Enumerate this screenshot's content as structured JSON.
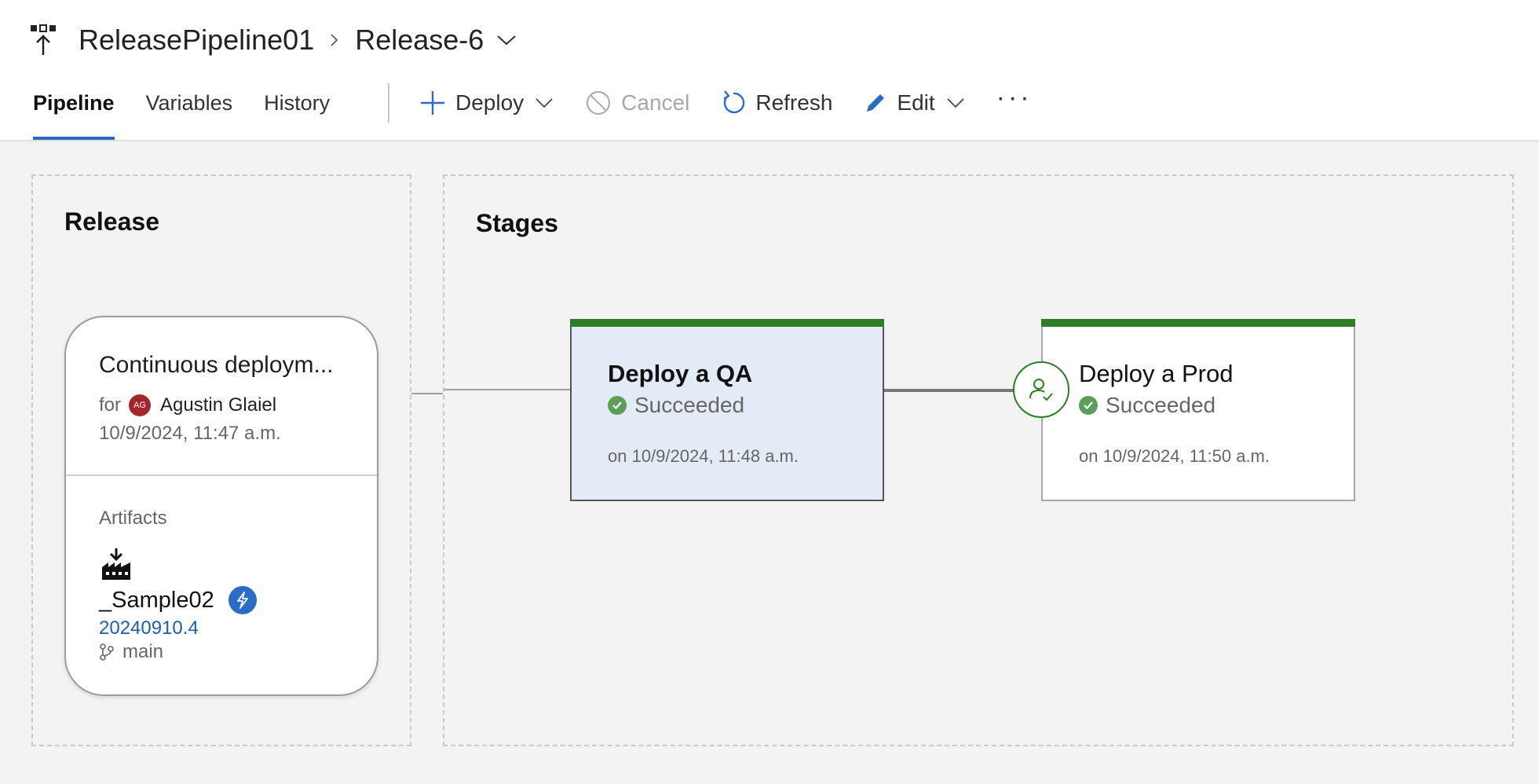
{
  "breadcrumb": {
    "pipeline": "ReleasePipeline01",
    "release": "Release-6"
  },
  "tabs": [
    {
      "label": "Pipeline",
      "active": true
    },
    {
      "label": "Variables",
      "active": false
    },
    {
      "label": "History",
      "active": false
    }
  ],
  "toolbar": {
    "deploy": "Deploy",
    "cancel": "Cancel",
    "refresh": "Refresh",
    "edit": "Edit",
    "more": "···"
  },
  "release_section": {
    "title": "Release",
    "card": {
      "title": "Continuous deploym...",
      "for_label": "for",
      "avatar_initials": "AG",
      "user": "Agustin Glaiel",
      "date": "10/9/2024, 11:47 a.m.",
      "artifacts_label": "Artifacts",
      "artifact": {
        "name": "_Sample02",
        "version": "20240910.4",
        "branch": "main"
      }
    }
  },
  "stages_section": {
    "title": "Stages",
    "stages": [
      {
        "name": "Deploy a QA",
        "status": "Succeeded",
        "date": "on 10/9/2024, 11:48 a.m."
      },
      {
        "name": "Deploy a Prod",
        "status": "Succeeded",
        "date": "on 10/9/2024, 11:50 a.m."
      }
    ]
  },
  "colors": {
    "accent": "#2b6cc4",
    "success": "#2e7d27",
    "selected_stage_bg": "#e2ebf6"
  }
}
